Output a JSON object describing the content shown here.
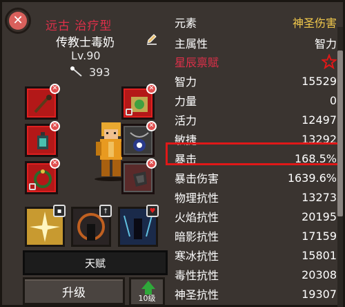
{
  "hero": {
    "tier": "远古 治疗型",
    "name": "传教士毒奶",
    "level": "Lv.90",
    "power": "393"
  },
  "equipment": {
    "left": [
      {
        "name": "staff-item",
        "state": "equipped"
      },
      {
        "name": "lantern-item",
        "state": "equipped"
      },
      {
        "name": "ring-item",
        "state": "locked"
      }
    ],
    "right": [
      {
        "name": "scroll-item",
        "state": "locked"
      },
      {
        "name": "amulet-item",
        "state": "equipped"
      },
      {
        "name": "rune-item",
        "state": "equipped"
      }
    ]
  },
  "skills": [
    {
      "name": "holy-light-skill",
      "badge_icon": "shield-icon"
    },
    {
      "name": "dark-aura-skill",
      "badge_icon": "sword-icon"
    },
    {
      "name": "summon-skill",
      "badge_icon": "heart-icon"
    }
  ],
  "buttons": {
    "talent": "天赋",
    "upgrade": "升级",
    "upgrade10": "10级"
  },
  "stats": {
    "element": {
      "label": "元素",
      "value": "神圣伤害"
    },
    "main_attr": {
      "label": "主属性",
      "value": "智力"
    },
    "talent": {
      "label": "星辰禀赋"
    },
    "rows": [
      {
        "label": "智力",
        "value": "15529"
      },
      {
        "label": "力量",
        "value": "0"
      },
      {
        "label": "活力",
        "value": "12497"
      },
      {
        "label": "敏捷",
        "value": "13292"
      },
      {
        "label": "暴击",
        "value": "168.5%"
      },
      {
        "label": "暴击伤害",
        "value": "1639.6%"
      },
      {
        "label": "物理抗性",
        "value": "13273"
      },
      {
        "label": "火焰抗性",
        "value": "20195"
      },
      {
        "label": "暗影抗性",
        "value": "17159"
      },
      {
        "label": "寒冰抗性",
        "value": "15801"
      },
      {
        "label": "毒性抗性",
        "value": "20308"
      },
      {
        "label": "神圣抗性",
        "value": "19307"
      }
    ]
  },
  "colors": {
    "tier": "#e0304a",
    "element_value": "#f2c94c",
    "highlight": "#e01818",
    "slot_red": "#b31818"
  }
}
